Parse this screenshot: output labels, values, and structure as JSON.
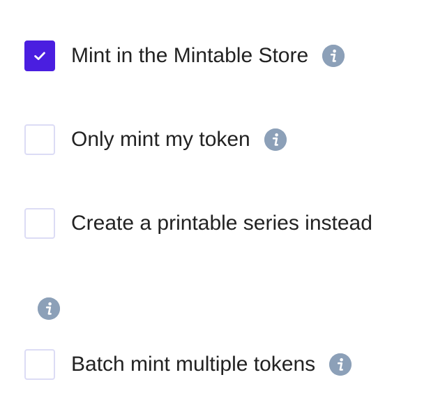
{
  "options": [
    {
      "label": "Mint in the Mintable Store",
      "checked": true,
      "icon": "info-icon"
    },
    {
      "label": "Only mint my token",
      "checked": false,
      "icon": "info-icon"
    },
    {
      "label": "Create a printable series instead",
      "checked": false
    },
    {
      "label": "Batch mint multiple tokens",
      "checked": false,
      "icon": "info-icon"
    }
  ],
  "colors": {
    "accent": "#4a1ee0",
    "checkbox_border": "#dcdcf5",
    "info_icon": "#8ca0b8",
    "text": "#222222"
  },
  "standalone_icon": "info-icon"
}
